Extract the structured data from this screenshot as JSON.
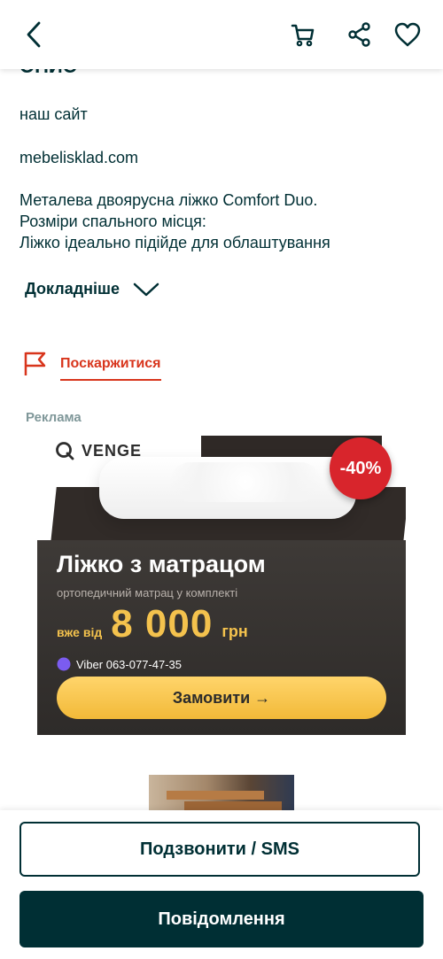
{
  "header": {
    "back_icon": "chevron-left-icon",
    "cart_icon": "cart-icon",
    "share_icon": "share-icon",
    "favorite_icon": "heart-icon"
  },
  "description": {
    "title": "Опис",
    "lines": [
      "наш сайт",
      "mebelisklad.com",
      "Металева двоярусна ліжко Comfort Duo.",
      "Розміри спального місця:",
      "Ліжко ідеально підійде для облаштування"
    ],
    "more_label": "Докладніше"
  },
  "report": {
    "label": "Поскаржитися"
  },
  "ad": {
    "label": "Реклама",
    "brand": "VENGE",
    "discount": "-40%",
    "headline": "Ліжко з матрацом",
    "subline": "ортопедичний матрац у комплекті",
    "price_prefix": "вже від",
    "price": "8 000",
    "currency": "грн",
    "viber": "Viber 063-077-47-35",
    "button": "Замовити →"
  },
  "actions": {
    "call_label": "Подзвонити / SMS",
    "message_label": "Повідомлення"
  },
  "colors": {
    "primary": "#002f34",
    "report": "#d8351c",
    "ad_accent": "#f4c24d",
    "discount": "#d8252c"
  }
}
